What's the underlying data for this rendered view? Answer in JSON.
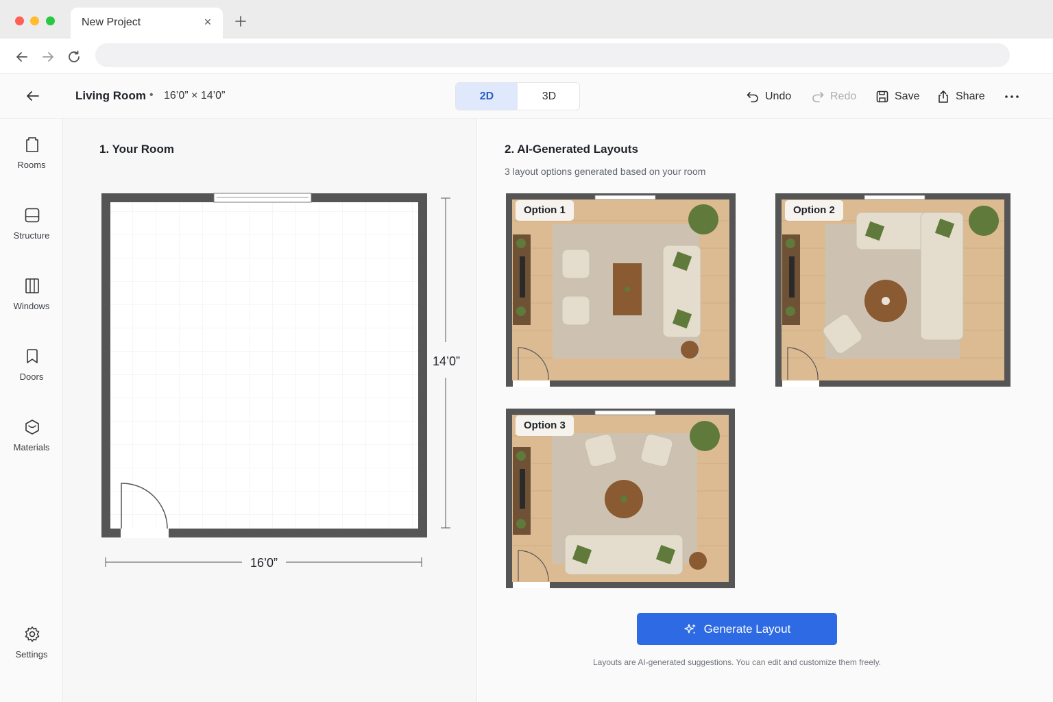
{
  "browser": {
    "tab_title": "New Project",
    "tab_close": "×",
    "url": ""
  },
  "toolbar": {
    "room_name": "Living Room",
    "separator": "•",
    "room_dims": "16’0” × 14’0”",
    "view_2d": "2D",
    "view_3d": "3D",
    "undo": "Undo",
    "redo": "Redo",
    "save": "Save",
    "share": "Share"
  },
  "sidebar": {
    "items": [
      {
        "label": "Rooms",
        "icon": "rooms-icon"
      },
      {
        "label": "Structure",
        "icon": "structure-icon"
      },
      {
        "label": "Windows",
        "icon": "windows-icon"
      },
      {
        "label": "Doors",
        "icon": "doors-icon"
      },
      {
        "label": "Materials",
        "icon": "materials-icon"
      }
    ],
    "settings": "Settings"
  },
  "left": {
    "title": "1. Your Room",
    "height_label": "14’0”",
    "width_label": "16’0”"
  },
  "right": {
    "title": "2. AI-Generated Layouts",
    "subtitle": "3 layout options generated based on your room",
    "options": [
      "Option 1",
      "Option 2",
      "Option 3"
    ],
    "generate_button": "Generate Layout",
    "footnote": "Layouts are AI-generated suggestions. You can edit and customize them freely."
  },
  "colors": {
    "accent": "#2d6ae3",
    "wall": "#555555",
    "floor_wood": "#dcbb93",
    "rug": "#cdc2b2",
    "sofa": "#e4dccd",
    "plant": "#5f7a3a"
  }
}
